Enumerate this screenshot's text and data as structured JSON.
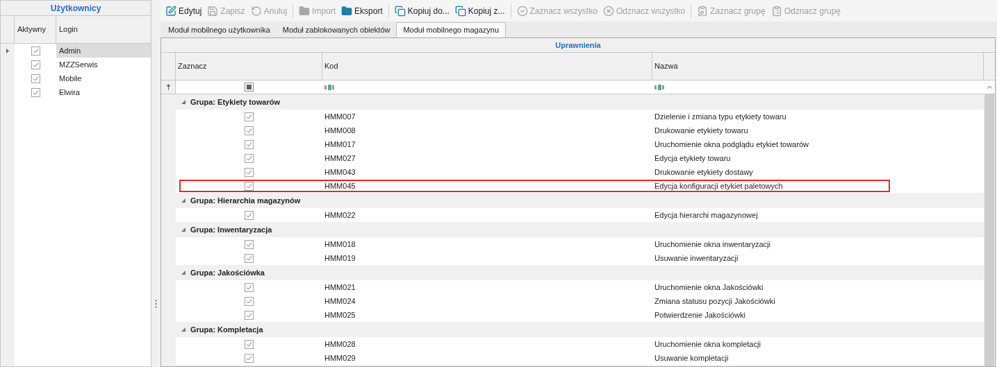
{
  "users_panel": {
    "title": "Użytkownicy",
    "columns": [
      "Aktywny",
      "Login"
    ],
    "rows": [
      {
        "active": true,
        "login": "Admin",
        "selected": true
      },
      {
        "active": true,
        "login": "MZZSerwis",
        "selected": false
      },
      {
        "active": true,
        "login": "Mobile",
        "selected": false
      },
      {
        "active": true,
        "login": "Elwira",
        "selected": false
      }
    ]
  },
  "toolbar": [
    {
      "label": "Edytuj",
      "kind": "edit",
      "disabled": false,
      "separator_after": false
    },
    {
      "label": "Zapisz",
      "kind": "save",
      "disabled": true,
      "separator_after": false
    },
    {
      "label": "Anuluj",
      "kind": "undo",
      "disabled": true,
      "separator_after": true
    },
    {
      "label": "Import",
      "kind": "folder",
      "disabled": true,
      "separator_after": false
    },
    {
      "label": "Eksport",
      "kind": "folder",
      "disabled": false,
      "separator_after": true
    },
    {
      "label": "Kopiuj do...",
      "kind": "copy_to",
      "disabled": false,
      "separator_after": false
    },
    {
      "label": "Kopiuj z...",
      "kind": "copy_from",
      "disabled": false,
      "separator_after": true
    },
    {
      "label": "Zaznacz wszystko",
      "kind": "check_all",
      "disabled": true,
      "separator_after": false
    },
    {
      "label": "Odznacz wszystko",
      "kind": "uncheck_all",
      "disabled": true,
      "separator_after": true
    },
    {
      "label": "Zaznacz grupę",
      "kind": "check_group",
      "disabled": true,
      "separator_after": false
    },
    {
      "label": "Odznacz grupę",
      "kind": "uncheck_group",
      "disabled": true,
      "separator_after": false
    }
  ],
  "tabs": [
    {
      "label": "Moduł mobilnego użytkownika",
      "selected": false
    },
    {
      "label": "Moduł zablokowanych obiektów",
      "selected": false
    },
    {
      "label": "Moduł mobilnego magazynu",
      "selected": true
    }
  ],
  "grid": {
    "band": "Uprawnienia",
    "columns": [
      "Zaznacz",
      "Kod",
      "Nazwa"
    ],
    "filter_checkbox_indeterminate": true,
    "groups": [
      {
        "label": "Grupa: Etykiety towarów",
        "expanded": true,
        "rows": [
          {
            "checked": true,
            "code": "HMM007",
            "name": "Dzielenie i zmiana typu etykiety towaru",
            "highlighted": false
          },
          {
            "checked": true,
            "code": "HMM008",
            "name": "Drukowanie etykiety towaru",
            "highlighted": false
          },
          {
            "checked": true,
            "code": "HMM017",
            "name": "Uruchomienie okna podglądu etykiet towarów",
            "highlighted": false
          },
          {
            "checked": true,
            "code": "HMM027",
            "name": "Edycja etykiety towaru",
            "highlighted": false
          },
          {
            "checked": true,
            "code": "HMM043",
            "name": "Drukowanie etykiety dostawy",
            "highlighted": false
          },
          {
            "checked": true,
            "code": "HMM045",
            "name": "Edycja konfiguracji etykiet paletowych",
            "highlighted": true
          }
        ]
      },
      {
        "label": "Grupa: Hierarchia magazynów",
        "expanded": true,
        "rows": [
          {
            "checked": true,
            "code": "HMM022",
            "name": "Edycja hierarchi magazynowej",
            "highlighted": false
          }
        ]
      },
      {
        "label": "Grupa: Inwentaryzacja",
        "expanded": true,
        "rows": [
          {
            "checked": true,
            "code": "HMM018",
            "name": "Uruchomienie okna inwentaryzacji",
            "highlighted": false
          },
          {
            "checked": true,
            "code": "HMM019",
            "name": "Usuwanie inwentaryzacji",
            "highlighted": false
          }
        ]
      },
      {
        "label": "Grupa: Jakościówka",
        "expanded": true,
        "rows": [
          {
            "checked": true,
            "code": "HMM021",
            "name": "Uruchomienie okna Jakościówki",
            "highlighted": false
          },
          {
            "checked": true,
            "code": "HMM024",
            "name": "Zmiana statusu pozycji Jakościówki",
            "highlighted": false
          },
          {
            "checked": true,
            "code": "HMM025",
            "name": "Potwierdzenie Jakościówki",
            "highlighted": false
          }
        ]
      },
      {
        "label": "Grupa: Kompletacja",
        "expanded": true,
        "rows": [
          {
            "checked": true,
            "code": "HMM028",
            "name": "Uruchomienie okna kompletacji",
            "highlighted": false
          },
          {
            "checked": true,
            "code": "HMM029",
            "name": "Usuwanie kompletacji",
            "highlighted": false
          }
        ]
      }
    ]
  }
}
